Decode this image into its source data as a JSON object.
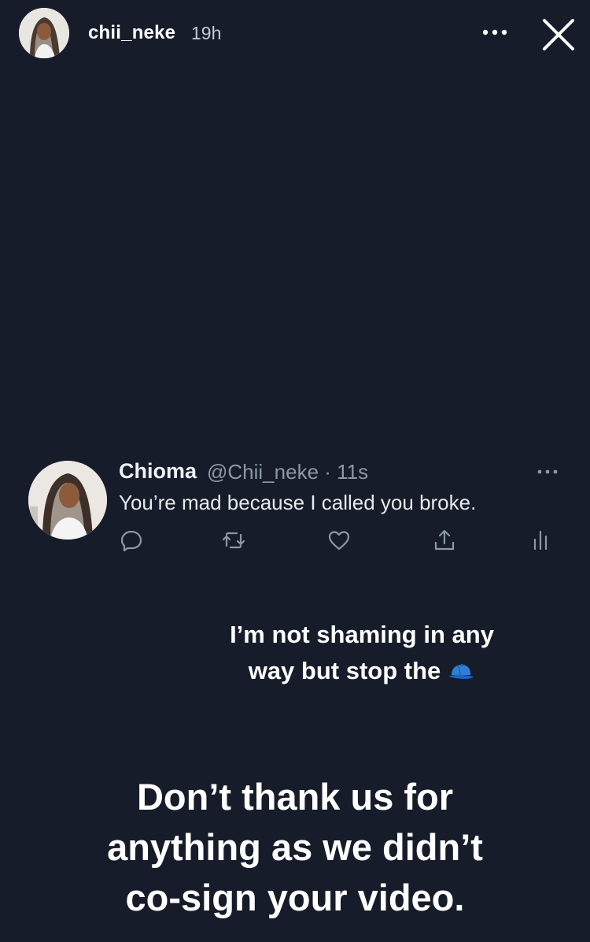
{
  "header": {
    "username": "chii_neke",
    "timestamp": "19h"
  },
  "tweet": {
    "display_name": "Chioma",
    "handle_time": "@Chii_neke · 11s",
    "text": "You’re mad because I called you broke."
  },
  "captions": {
    "small_line1": "I’m not shaming in any",
    "small_line2": "way but stop the",
    "small_emoji": "blue-cap-icon",
    "large_line1": "Don’t thank us for",
    "large_line2": "anything as we didn’t",
    "large_line3": "co-sign your video."
  },
  "colors": {
    "background": "#161c29",
    "text_primary": "#ffffff",
    "text_secondary": "#8b98a5",
    "cap_blue": "#2f7fd6"
  }
}
